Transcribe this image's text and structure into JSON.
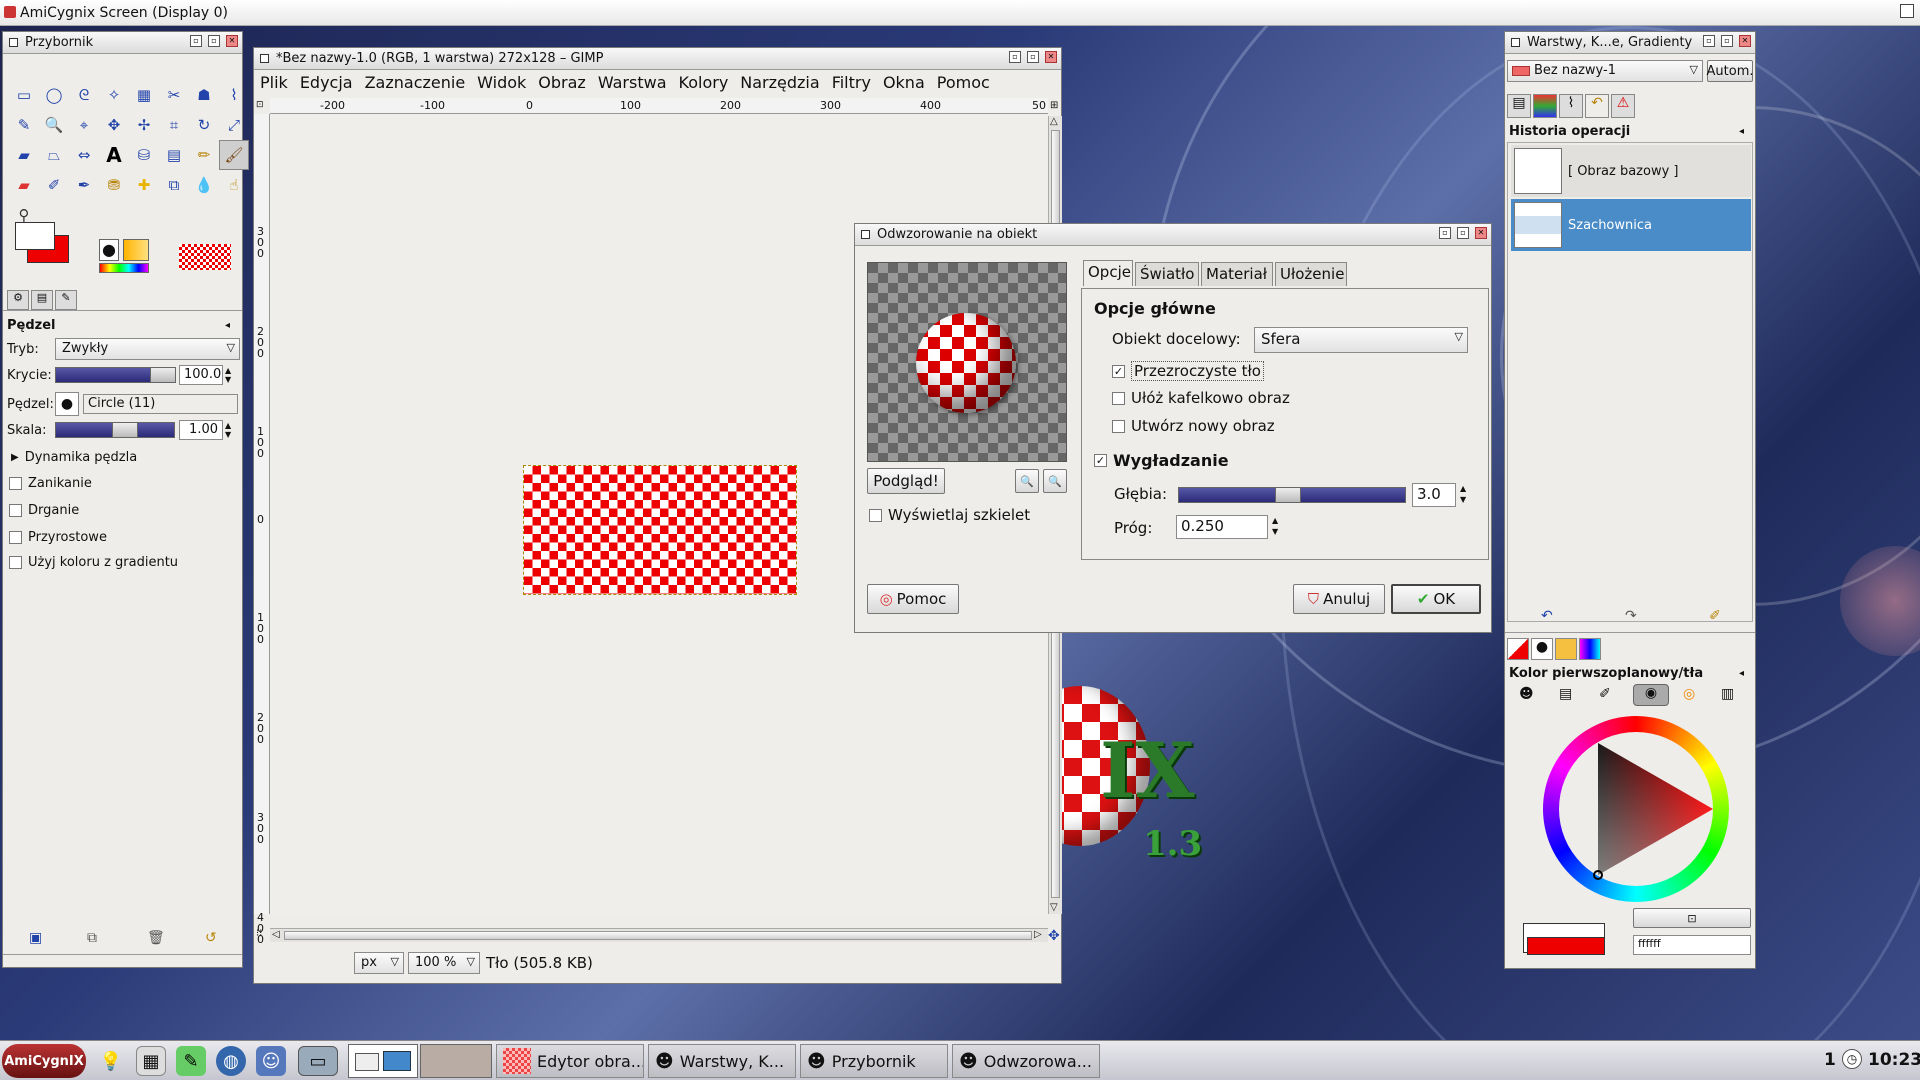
{
  "screen": {
    "title": "AmiCygnix Screen (Display 0)"
  },
  "toolbox": {
    "title": "Przybornik",
    "tool_options_title": "Pędzel",
    "mode_label": "Tryb:",
    "mode_value": "Zwykły",
    "opacity_label": "Krycie:",
    "opacity_value": "100.0",
    "brush_label": "Pędzel:",
    "brush_value": "Circle (11)",
    "scale_label": "Skala:",
    "scale_value": "1.00",
    "dynamics_label": "Dynamika pędzla",
    "options": [
      "Zanikanie",
      "Drganie",
      "Przyrostowe",
      "Użyj koloru z gradientu"
    ]
  },
  "image_window": {
    "title": "*Bez nazwy-1.0 (RGB, 1 warstwa) 272x128 – GIMP",
    "menu": [
      "Plik",
      "Edycja",
      "Zaznaczenie",
      "Widok",
      "Obraz",
      "Warstwa",
      "Kolory",
      "Narzędzia",
      "Filtry",
      "Okna",
      "Pomoc"
    ],
    "ruler_h": [
      "-200",
      "-100",
      "0",
      "100",
      "200",
      "300",
      "400",
      "50"
    ],
    "ruler_v": [
      "3\n0\n0",
      "2\n0\n0",
      "1\n0\n0",
      "0",
      "1\n0\n0",
      "2\n0\n0",
      "3\n0\n0",
      "4\n0\n0"
    ],
    "unit": "px",
    "zoom": "100 %",
    "status": "Tło (505.8 KB)"
  },
  "dialog": {
    "title": "Odwzorowanie na obiekt",
    "tabs": [
      "Opcje",
      "Światło",
      "Materiał",
      "Ułożenie"
    ],
    "preview_button": "Podgląd!",
    "show_wireframe": "Wyświetlaj szkielet",
    "section_title": "Opcje główne",
    "target_label": "Obiekt docelowy:",
    "target_value": "Sfera",
    "transparent_bg": "Przezroczyste tło",
    "tile_image": "Ułóż kafelkowo obraz",
    "new_image": "Utwórz nowy obraz",
    "antialiasing": "Wygładzanie",
    "depth_label": "Głębia:",
    "depth_value": "3.0",
    "threshold_label": "Próg:",
    "threshold_value": "0.250",
    "help_button": "Pomoc",
    "cancel_button": "Anuluj",
    "ok_button": "OK"
  },
  "layers_panel": {
    "title": "Warstwy, K...e, Gradienty",
    "image_value": "Bez nazwy-1",
    "auto_button": "Autom.",
    "history_title": "Historia operacji",
    "history": [
      "[ Obraz bazowy ]",
      "Szachownica"
    ],
    "color_title": "Kolor pierwszoplanowy/tła",
    "hex_value": "ffffff"
  },
  "desktop_logo": {
    "version": "1.3",
    "text": "IX"
  },
  "taskbar": {
    "start_label": "AmiCygnIX",
    "tasks": [
      "Edytor obra...",
      "Warstwy, K...",
      "Przybornik",
      "Odwzorowa..."
    ],
    "workspace": "1",
    "clock": "10:23"
  },
  "colors": {
    "accent": "#4a8cc8",
    "checker_red": "#ee0000"
  }
}
